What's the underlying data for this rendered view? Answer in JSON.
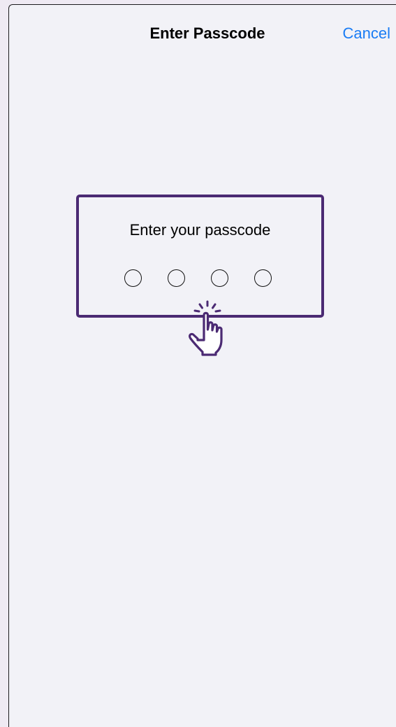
{
  "header": {
    "title": "Enter Passcode",
    "cancel_label": "Cancel"
  },
  "passcode": {
    "prompt": "Enter your passcode",
    "digit_count": 4,
    "filled_digits": 0
  },
  "colors": {
    "accent": "#1a7cf4",
    "highlight": "#4b2a73",
    "background": "#f2f2f7"
  },
  "icons": {
    "cursor": "tap-hand-icon",
    "digit": "empty-circle-icon"
  }
}
